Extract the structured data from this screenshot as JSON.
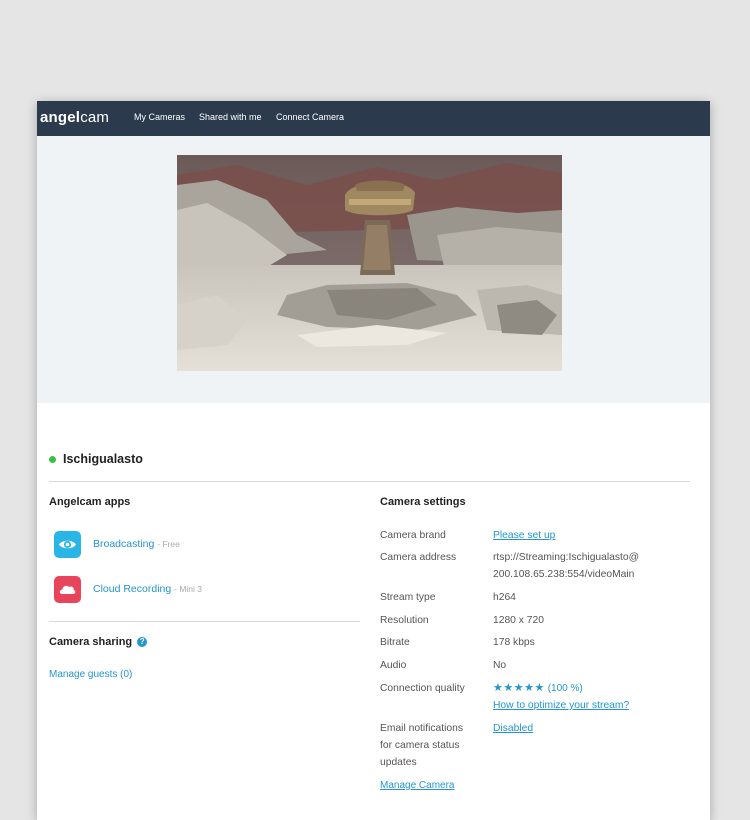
{
  "header": {
    "logo_bold": "angel",
    "logo_light": "cam",
    "nav": [
      "My Cameras",
      "Shared with me",
      "Connect Camera"
    ]
  },
  "camera": {
    "name": "Ischigualasto",
    "status_color": "#3fbf3f"
  },
  "apps": {
    "title": "Angelcam apps",
    "items": [
      {
        "name": "Broadcasting",
        "sub": "- Free",
        "icon": "eye-icon",
        "color": "#29b5e5"
      },
      {
        "name": "Cloud Recording",
        "sub": "- Mini 3",
        "icon": "cloud-icon",
        "color": "#e8455c"
      }
    ]
  },
  "sharing": {
    "title": "Camera sharing",
    "manage_guests": "Manage guests (0)"
  },
  "settings": {
    "title": "Camera settings",
    "rows": [
      {
        "label": "Camera brand",
        "value": "Please set up"
      },
      {
        "label": "Camera address",
        "value_line1": "rtsp://Streaming:Ischigualasto@",
        "value_line2": "200.108.65.238:554/videoMain"
      },
      {
        "label": "Stream type",
        "value": "h264"
      },
      {
        "label": "Resolution",
        "value": "1280 x 720"
      },
      {
        "label": "Bitrate",
        "value": "178 kbps"
      },
      {
        "label": "Audio",
        "value": "No"
      },
      {
        "label": "Connection quality",
        "stars": 5,
        "percent": "(100 %)",
        "optimize_link": "How to optimize your stream?"
      },
      {
        "label_line1": "Email notifications",
        "label_line2": "for camera status",
        "label_line3": "updates",
        "value": "Disabled"
      }
    ],
    "manage_camera": "Manage Camera"
  },
  "accent_color": "#2196d0",
  "topbar_color": "#2c3a4d"
}
